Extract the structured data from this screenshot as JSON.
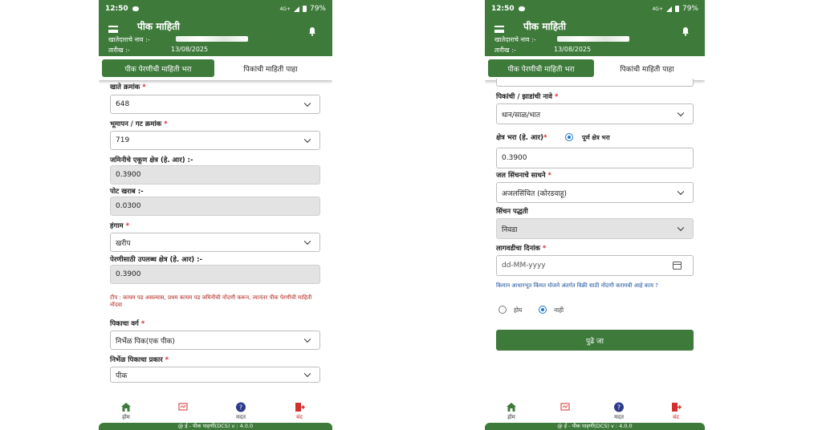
{
  "status": {
    "time": "12:50",
    "network": "4G+",
    "battery": "79%"
  },
  "header": {
    "title": "पीक माहिती",
    "owner_label": "खातेदाराचे नाव :-",
    "date_label": "तारीख :-",
    "date_value": "13/08/2025"
  },
  "tabs": {
    "fill": "पीक पेरणीची माहिती भरा",
    "view": "पिकांची माहिती पाहा"
  },
  "screen1": {
    "account_no": {
      "label": "खाते क्रमांक",
      "value": "648"
    },
    "survey_no": {
      "label": "भूमापन / गट क्रमांक",
      "value": "719"
    },
    "total_area": {
      "label": "जमिनीचे एकूण क्षेत्र (हे. आर) :-",
      "value": "0.3900"
    },
    "pot_kharab": {
      "label": "पोट खराब :-",
      "value": "0.0300"
    },
    "season": {
      "label": "हंगाम",
      "value": "खरीप"
    },
    "available_area": {
      "label": "पेरणीसाठी उपलब्ध क्षेत्र (हे. आर) :-",
      "value": "0.3900"
    },
    "note": "टीप : कायम पड असल्यास, प्रथम कायम पड जमिनीची नोंदणी करून, त्यानंतर पीक पेरणीची माहिती नोंदवा",
    "crop_class": {
      "label": "पिकाचा वर्ग",
      "value": "निर्भेळ पिक(एक पीक)"
    },
    "crop_type": {
      "label": "निर्भेळ पिकाचा प्रकार",
      "value": "पीक"
    }
  },
  "screen2": {
    "crop_names": {
      "label": "पिकांची / झाडांची नावे",
      "value": "धान/साळ/भात"
    },
    "area_fill": {
      "label": "क्षेत्र भरा (हे. आर)",
      "full_area_option": "पूर्ण क्षेत्र भरा",
      "value": "0.3900"
    },
    "irrigation_source": {
      "label": "जल सिंचनाचे साधने",
      "value": "अजलसिंचित (कोरडवाहू)"
    },
    "irrigation_method": {
      "label": "सिंचन पद्धती",
      "value": "निवडा"
    },
    "sowing_date": {
      "label": "लागवडीचा दिनांक",
      "placeholder": "dd-MM-yyyy"
    },
    "msp_question": "किमान आधारभूत किंमत योजने अंतर्गत विक्री साठी नोंदणी करायची आहे काय ?",
    "msp_yes": "होय",
    "msp_no": "नाही",
    "next_button": "पुढे जा"
  },
  "nav": {
    "home": "होम",
    "help": "मदत",
    "close": "बंद"
  },
  "footer": "@ ई - पीक पाहणी(DCS) v : 4.0.0",
  "colors": {
    "primary": "#3e7b3b",
    "required": "#d32f2f",
    "note": "#b3261e",
    "question": "#1a4f9c"
  }
}
